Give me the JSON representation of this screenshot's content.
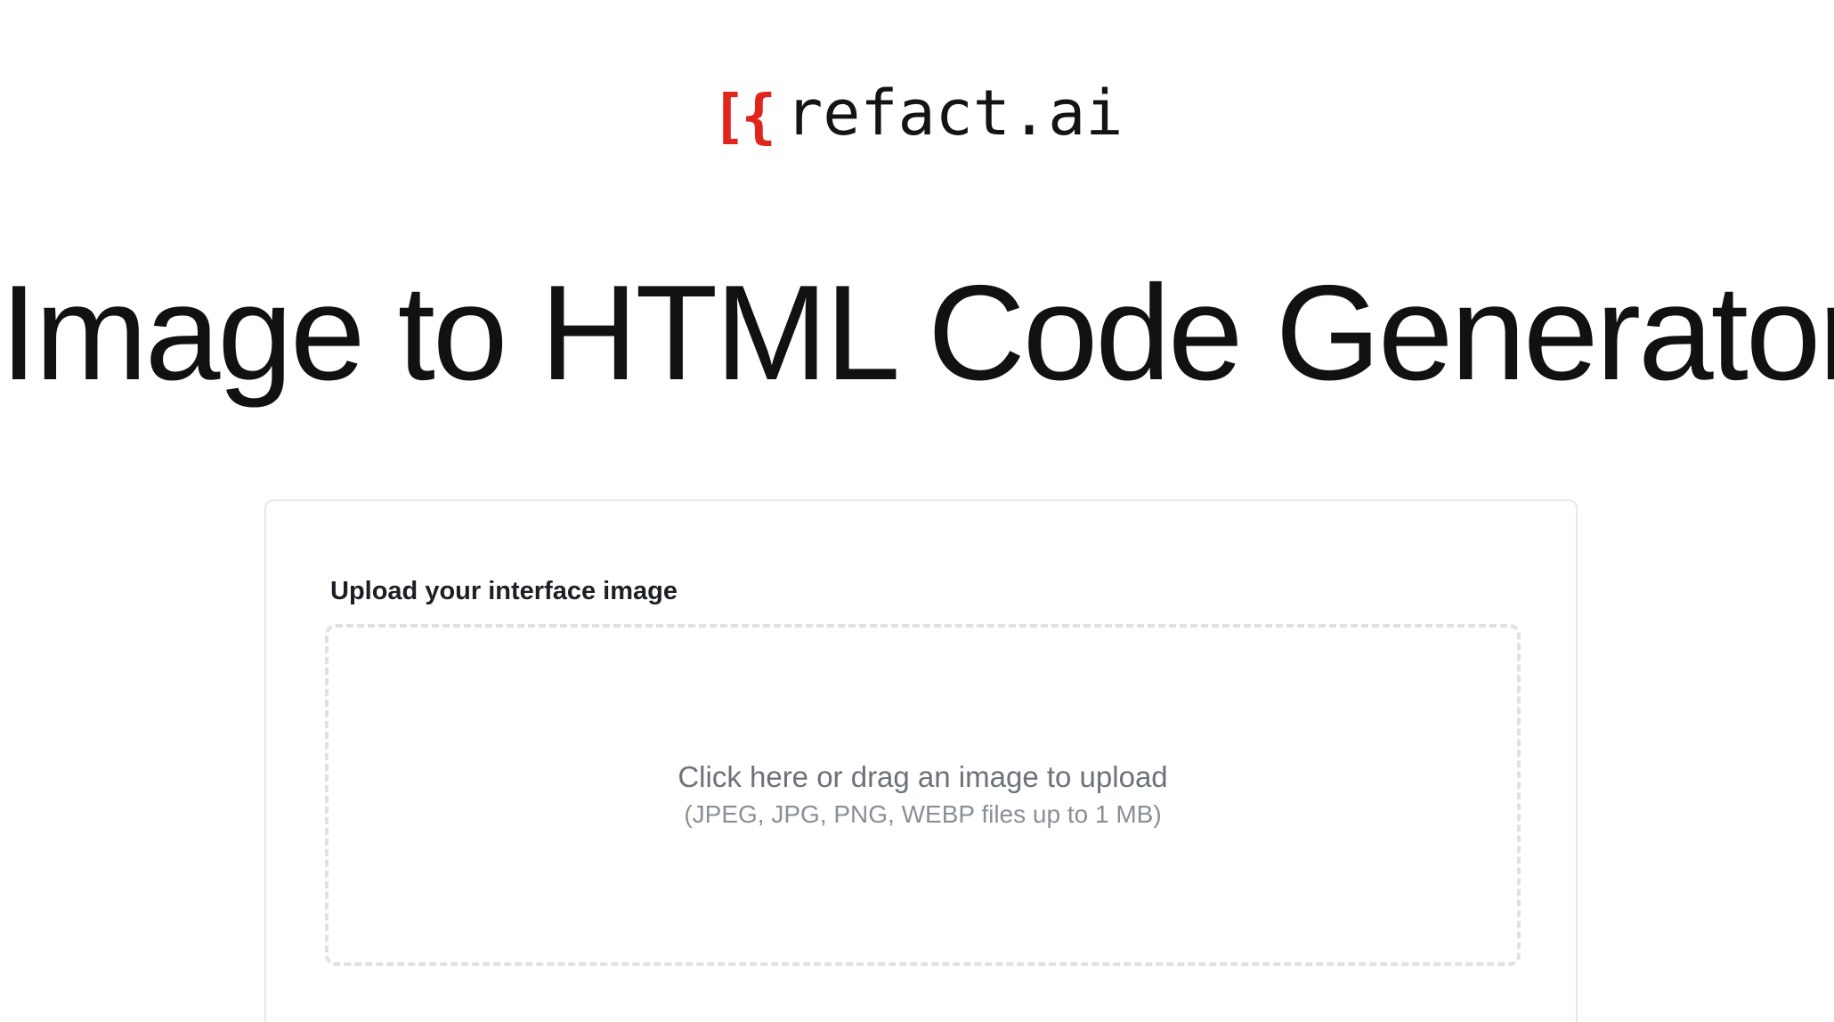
{
  "header": {
    "logo_mark": "[{",
    "logo_text": "refact.ai",
    "brand_color": "#e0261b"
  },
  "main": {
    "title": "Image to HTML Code Generator"
  },
  "upload": {
    "label": "Upload your interface image",
    "dropzone_text": "Click here or drag an image to upload",
    "dropzone_hint": "(JPEG, JPG, PNG, WEBP files up to 1 MB)"
  }
}
